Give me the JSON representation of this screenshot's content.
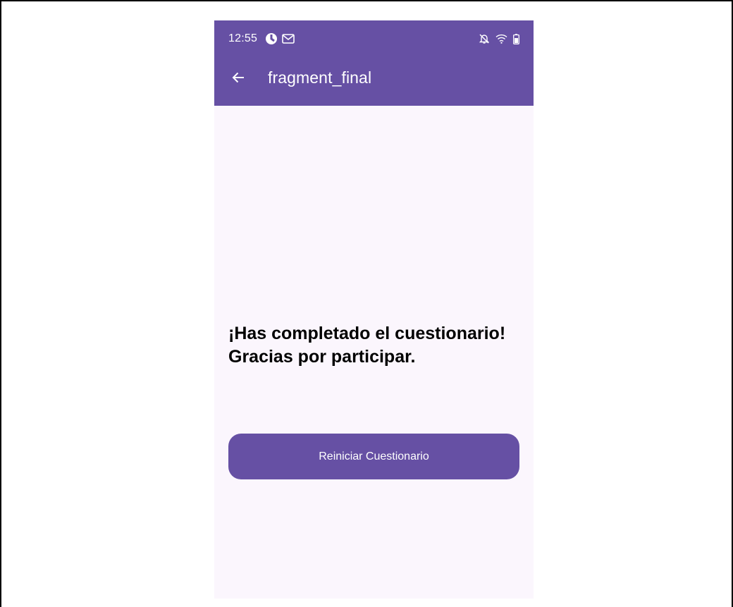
{
  "status_bar": {
    "time": "12:55",
    "left_icons": [
      "app-notification-icon",
      "gmail-icon"
    ],
    "right_icons": [
      "notifications-off-icon",
      "wifi-icon",
      "battery-icon"
    ]
  },
  "app_bar": {
    "title": "fragment_final",
    "back_icon": "arrow-back-icon"
  },
  "main": {
    "message": "¡Has completado el cuestionario! Gracias por participar.",
    "restart_label": "Reiniciar Cuestionario"
  },
  "colors": {
    "primary": "#6650a4",
    "background": "#fbf6fd",
    "text": "#000000",
    "on_primary": "#ffffff"
  }
}
